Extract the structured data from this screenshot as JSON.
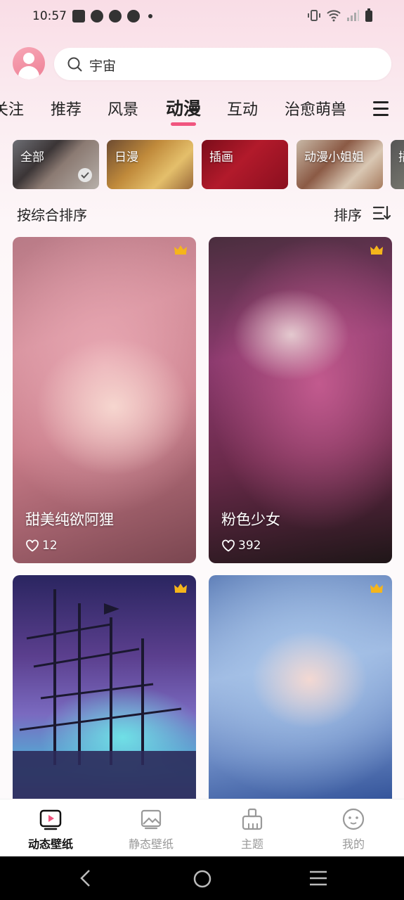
{
  "status_bar": {
    "time": "10:57"
  },
  "header": {
    "search_placeholder": "宇宙"
  },
  "tabs": [
    {
      "label": "关注"
    },
    {
      "label": "推荐"
    },
    {
      "label": "风景"
    },
    {
      "label": "动漫",
      "active": true
    },
    {
      "label": "互动"
    },
    {
      "label": "治愈萌兽"
    }
  ],
  "chips": [
    {
      "label": "全部",
      "selected": true
    },
    {
      "label": "日漫"
    },
    {
      "label": "插画"
    },
    {
      "label": "动漫小姐姐"
    },
    {
      "label": "插"
    }
  ],
  "sort": {
    "left_label": "按综合排序",
    "right_label": "排序"
  },
  "cards": [
    {
      "title": "甜美纯欲阿狸",
      "likes": "12",
      "crown": true
    },
    {
      "title": "粉色少女",
      "likes": "392",
      "crown": true
    },
    {
      "title": "",
      "likes": "",
      "crown": true
    },
    {
      "title": "",
      "likes": "",
      "crown": true
    }
  ],
  "bottom_nav": [
    {
      "label": "动态壁纸",
      "icon": "play-video-icon",
      "active": true
    },
    {
      "label": "静态壁纸",
      "icon": "image-icon"
    },
    {
      "label": "主题",
      "icon": "brush-icon"
    },
    {
      "label": "我的",
      "icon": "face-icon"
    }
  ],
  "colors": {
    "accent": "#f0557f",
    "crown": "#f5b51b"
  }
}
